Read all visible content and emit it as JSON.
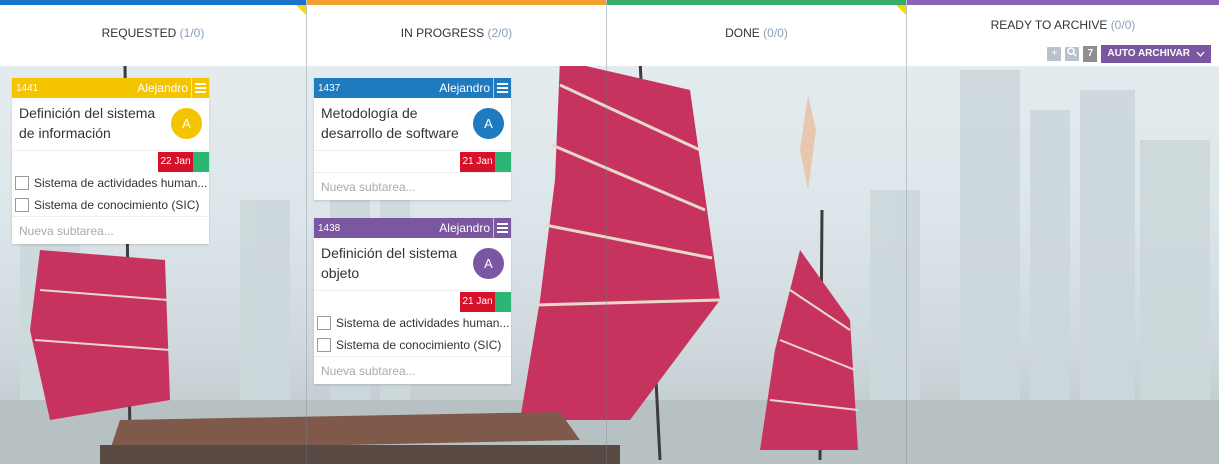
{
  "colors": {
    "requested": "#1a73c8",
    "in_progress": "#f0a030",
    "done": "#3aaa6a",
    "ready_to_archive": "#8a63b6",
    "card_yellow": "#f5c400",
    "card_blue": "#1f7bbf",
    "card_purple": "#7a57a0",
    "date_red": "#d6122a",
    "date_green": "#2bb673"
  },
  "columns": [
    {
      "title": "REQUESTED",
      "count": "(1/0)"
    },
    {
      "title": "IN PROGRESS",
      "count": "(2/0)"
    },
    {
      "title": "DONE",
      "count": "(0/0)"
    },
    {
      "title": "READY TO ARCHIVE",
      "count": "(0/0)"
    }
  ],
  "archive_tools": {
    "add_icon": "plus-icon",
    "search_icon": "search-icon",
    "auto_count": "7",
    "auto_label": "AUTO ARCHIVAR",
    "chevron_icon": "chevron-down-icon"
  },
  "cards": [
    {
      "id": "1441",
      "owner": "Alejandro",
      "title": "Definición del sistema de información",
      "avatar": "A",
      "date": "22 Jan",
      "subtasks": [
        "Sistema de actividades human...",
        "Sistema de conocimiento (SIC)"
      ],
      "new_subtask_placeholder": "Nueva subtarea..."
    },
    {
      "id": "1437",
      "owner": "Alejandro",
      "title": "Metodología de desarrollo de software",
      "avatar": "A",
      "date": "21 Jan",
      "subtasks": [],
      "new_subtask_placeholder": "Nueva subtarea..."
    },
    {
      "id": "1438",
      "owner": "Alejandro",
      "title": "Definición del sistema objeto",
      "avatar": "A",
      "date": "21 Jan",
      "subtasks": [
        "Sistema de actividades human...",
        "Sistema de conocimiento (SIC)"
      ],
      "new_subtask_placeholder": "Nueva subtarea..."
    }
  ]
}
